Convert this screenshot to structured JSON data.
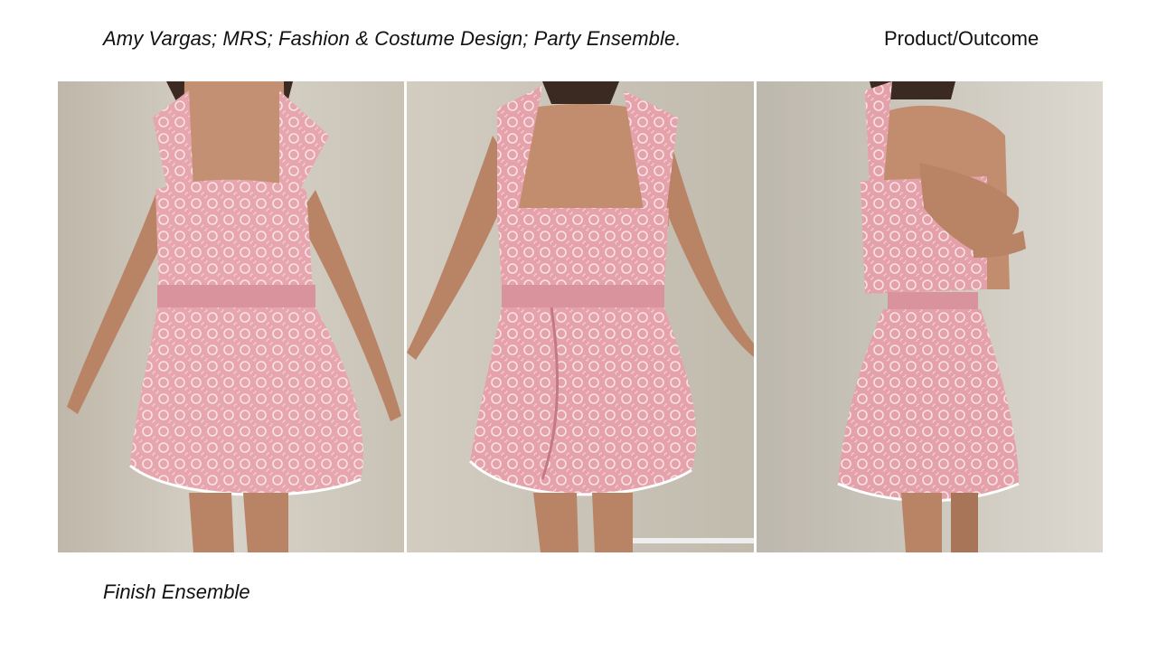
{
  "slide": {
    "title": "Amy Vargas; MRS; Fashion & Costume Design; Party Ensemble.",
    "section": "Product/Outcome",
    "caption": "Finish Ensemble"
  },
  "photos": [
    {
      "view": "front",
      "subject": "pink brocade party ensemble front view"
    },
    {
      "view": "back",
      "subject": "pink brocade party ensemble back view"
    },
    {
      "view": "side",
      "subject": "pink brocade party ensemble side view"
    }
  ],
  "colors": {
    "fabric": "#e9a9b0",
    "fabric_shadow": "#cf8a93",
    "fabric_highlight": "#f6dde0",
    "wall": "#cfcbc2",
    "skin": "#b98466",
    "hair": "#3a2a22"
  }
}
